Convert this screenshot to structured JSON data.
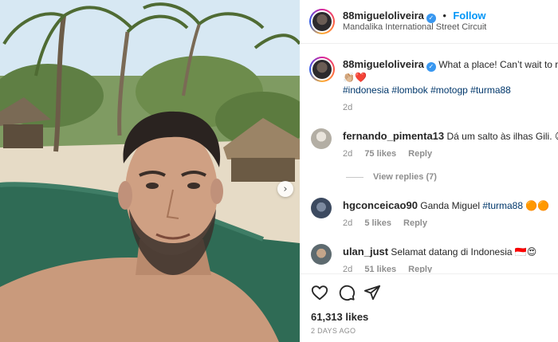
{
  "post": {
    "username": "88migueloliveira",
    "verified_icon": "verified-badge-icon",
    "follow_label": "Follow",
    "location": "Mandalika International Street Circuit",
    "carousel_next_icon": "›"
  },
  "caption": {
    "username": "88migueloliveira",
    "text": "What a place! Can’t wait to ride",
    "emoji_line": "👏🏼❤️",
    "hashtags": [
      "#indonesia",
      "#lombok",
      "#motogp",
      "#turma88"
    ],
    "time": "2d"
  },
  "comments": [
    {
      "username": "fernando_pimenta13",
      "text": "Dá um salto às ilhas Gili. 😉",
      "time": "2d",
      "likes": "75 likes",
      "reply_label": "Reply",
      "view_replies": "View replies (7)"
    },
    {
      "username": "hgconceicao90",
      "text": "Ganda Miguel ",
      "hashtag": "#turma88",
      "emoji": "🟠🟠",
      "time": "2d",
      "likes": "5 likes",
      "reply_label": "Reply"
    },
    {
      "username": "ulan_just",
      "text": "Selamat datang di Indonesia 🇮🇩😍",
      "time": "2d",
      "likes": "51 likes",
      "reply_label": "Reply"
    }
  ],
  "actions": {
    "like_icon": "heart-icon",
    "comment_icon": "comment-icon",
    "share_icon": "paper-plane-icon"
  },
  "likes_count": "61,313 likes",
  "posted": "2 DAYS AGO",
  "colors": {
    "link_blue": "#0095f6",
    "hashtag_blue": "#00376b",
    "muted_gray": "#8e8e8e",
    "verified_blue": "#3897f0"
  }
}
